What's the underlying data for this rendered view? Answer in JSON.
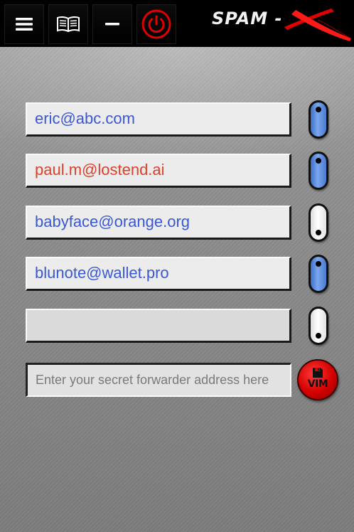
{
  "header": {
    "buttons": [
      {
        "name": "menu",
        "icon": "hamburger-menu-icon"
      },
      {
        "name": "book",
        "icon": "open-book-icon"
      },
      {
        "name": "minimize",
        "icon": "minus-icon"
      },
      {
        "name": "power",
        "icon": "power-icon",
        "color": "#e00000"
      }
    ],
    "logo": {
      "text": "SPAM -",
      "mark": "X",
      "mark_color": "#e00000"
    }
  },
  "addresses": [
    {
      "email": "eric@abc.com",
      "color": "blue",
      "enabled": true
    },
    {
      "email": "paul.m@lostend.ai",
      "color": "red",
      "enabled": true
    },
    {
      "email": "babyface@orange.org",
      "color": "blue",
      "enabled": false
    },
    {
      "email": "blunote@wallet.pro",
      "color": "blue",
      "enabled": true
    },
    {
      "email": "",
      "color": "blue",
      "enabled": false
    }
  ],
  "secret": {
    "placeholder": "Enter your secret forwarder address here",
    "value": ""
  },
  "save_button": {
    "label": "VIM",
    "icon": "floppy-disk-icon"
  },
  "colors": {
    "email_blue": "#3a58d6",
    "email_red": "#e0402a",
    "toggle_on": "#5b8ddc",
    "toggle_off": "#ffffff",
    "accent_red": "#e00000"
  }
}
